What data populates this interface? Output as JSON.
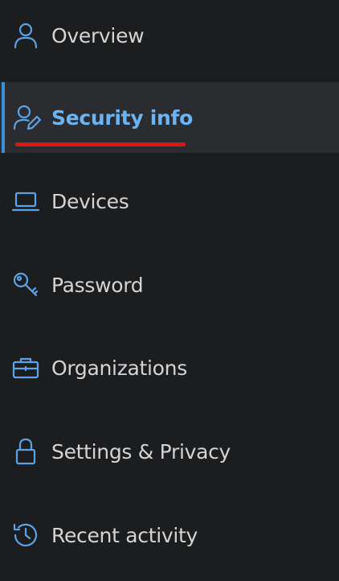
{
  "sidebar": {
    "items": [
      {
        "label": "Overview",
        "icon": "person-icon"
      },
      {
        "label": "Security info",
        "icon": "person-edit-icon",
        "active": true
      },
      {
        "label": "Devices",
        "icon": "laptop-icon"
      },
      {
        "label": "Password",
        "icon": "key-icon"
      },
      {
        "label": "Organizations",
        "icon": "briefcase-icon"
      },
      {
        "label": "Settings & Privacy",
        "icon": "lock-icon"
      },
      {
        "label": "Recent activity",
        "icon": "history-icon"
      }
    ]
  },
  "colors": {
    "background": "#1c1d1f",
    "active_background": "#2a2c2f",
    "accent": "#5aa3e6",
    "active_text": "#6bb3f2",
    "text": "#d4d4d4",
    "annotation": "#e01515"
  }
}
